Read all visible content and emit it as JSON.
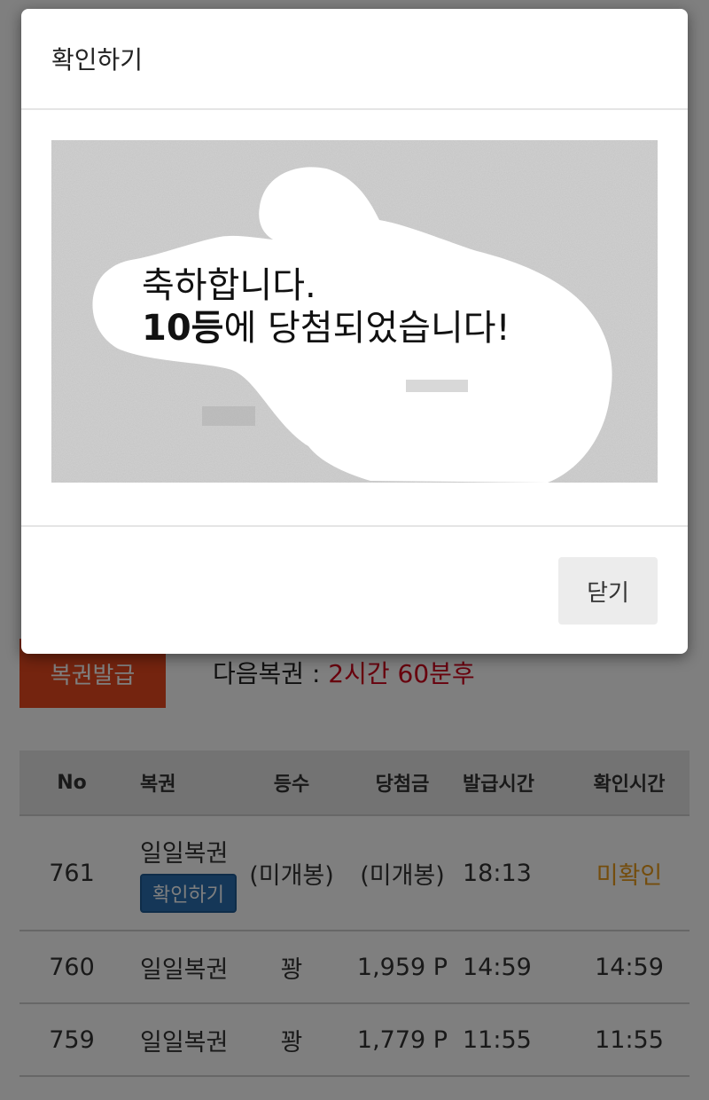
{
  "issue": {
    "button_label": "복권발급",
    "next_label": "다음복권 : ",
    "next_value": "2시간 60분후"
  },
  "table": {
    "headers": [
      "No",
      "복권",
      "등수",
      "당첨금",
      "발급시간",
      "확인시간"
    ],
    "rows": [
      {
        "no": "761",
        "lottery": "일일복권",
        "action": "확인하기",
        "rank": "(미개봉)",
        "prize": "(미개봉)",
        "issued": "18:13",
        "checked": "미확인"
      },
      {
        "no": "760",
        "lottery": "일일복권",
        "rank": "꽝",
        "prize": "1,959 P",
        "issued": "14:59",
        "checked": "14:59"
      },
      {
        "no": "759",
        "lottery": "일일복권",
        "rank": "꽝",
        "prize": "1,779 P",
        "issued": "11:55",
        "checked": "11:55"
      }
    ]
  },
  "modal": {
    "title": "확인하기",
    "message_line1": "축하합니다.",
    "rank_text": "10등",
    "message_line2_rest": "에 당첨되었습니다!",
    "close_label": "닫기"
  },
  "colors": {
    "issue_button": "#e8491f",
    "next_value": "#d0021b",
    "confirm_button": "#2a6fb0",
    "unconfirmed": "#e89a1b"
  }
}
